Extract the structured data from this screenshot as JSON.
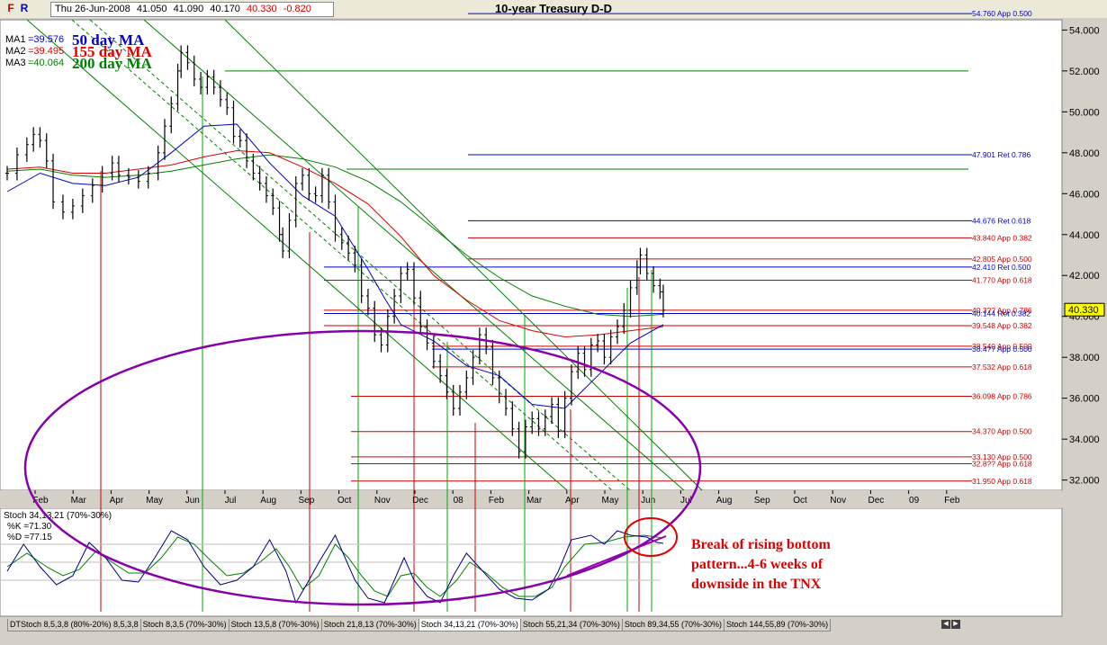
{
  "window": {
    "title": "10-year Treasury D-D",
    "btn_f": "F",
    "btn_r": "R"
  },
  "quote": {
    "date": "Thu 26-Jun-2008",
    "open": "41.050",
    "high": "41.090",
    "low": "40.170",
    "close": "40.330",
    "change": "-0.820"
  },
  "ma_legend": [
    {
      "label": "MA1",
      "value": "=39.576",
      "big": "50 day MA",
      "color": "#0000cc"
    },
    {
      "label": "MA2",
      "value": "=39.495",
      "big": "155 day MA",
      "color": "#dd0000"
    },
    {
      "label": "MA3",
      "value": "=40.064",
      "big": "200 day MA",
      "color": "#008000"
    }
  ],
  "chart_data": {
    "type": "candlestick",
    "title": "10-year Treasury D-D",
    "y_axis": {
      "min": 31.5,
      "max": 54.5,
      "ticks": [
        32,
        34,
        36,
        38,
        40,
        42,
        44,
        46,
        48,
        50,
        52,
        54
      ],
      "tick_labels": [
        "32.000",
        "34.000",
        "36.000",
        "38.000",
        "40.000",
        "42.000",
        "44.000",
        "46.000",
        "48.000",
        "50.000",
        "52.000",
        "54.000"
      ],
      "last_price_label": "40.330"
    },
    "x_axis": {
      "labels": [
        "Feb",
        "Mar",
        "Apr",
        "May",
        "Jun",
        "Jul",
        "Aug",
        "Sep",
        "Oct",
        "Nov",
        "Dec",
        "08",
        "Feb",
        "Mar",
        "Apr",
        "May",
        "Jun",
        "Jul",
        "Aug",
        "Sep",
        "Oct",
        "Nov",
        "Dec",
        "09",
        "Feb"
      ]
    },
    "price": [
      [
        0,
        47.0
      ],
      [
        3,
        47.9
      ],
      [
        6,
        48.4
      ],
      [
        8,
        48.9
      ],
      [
        10,
        48.6
      ],
      [
        12,
        47.6
      ],
      [
        14,
        45.6
      ],
      [
        17,
        45.1
      ],
      [
        20,
        45.4
      ],
      [
        23,
        45.9
      ],
      [
        26,
        46.4
      ],
      [
        29,
        47.0
      ],
      [
        32,
        47.5
      ],
      [
        34,
        46.9
      ],
      [
        37,
        46.8
      ],
      [
        40,
        46.6
      ],
      [
        43,
        47.0
      ],
      [
        46,
        48.0
      ],
      [
        48,
        49.3
      ],
      [
        50,
        50.4
      ],
      [
        52,
        52.0
      ],
      [
        53,
        52.9
      ],
      [
        55,
        52.4
      ],
      [
        57,
        51.6
      ],
      [
        59,
        51.2
      ],
      [
        61,
        51.7
      ],
      [
        63,
        51.2
      ],
      [
        65,
        50.6
      ],
      [
        67,
        50.2
      ],
      [
        69,
        48.8
      ],
      [
        71,
        48.6
      ],
      [
        73,
        47.6
      ],
      [
        75,
        47.0
      ],
      [
        77,
        46.5
      ],
      [
        79,
        45.9
      ],
      [
        81,
        45.3
      ],
      [
        83,
        44.0
      ],
      [
        84,
        43.2
      ],
      [
        86,
        44.7
      ],
      [
        88,
        46.5
      ],
      [
        90,
        46.9
      ],
      [
        92,
        46.0
      ],
      [
        94,
        45.9
      ],
      [
        96,
        46.9
      ],
      [
        98,
        45.6
      ],
      [
        100,
        44.0
      ],
      [
        102,
        43.6
      ],
      [
        104,
        43.1
      ],
      [
        106,
        42.5
      ],
      [
        108,
        41.0
      ],
      [
        110,
        40.4
      ],
      [
        112,
        39.1
      ],
      [
        114,
        38.6
      ],
      [
        116,
        40.0
      ],
      [
        118,
        41.0
      ],
      [
        120,
        42.1
      ],
      [
        122,
        42.3
      ],
      [
        124,
        40.9
      ],
      [
        126,
        39.5
      ],
      [
        128,
        38.7
      ],
      [
        130,
        37.8
      ],
      [
        132,
        37.1
      ],
      [
        134,
        36.3
      ],
      [
        136,
        35.5
      ],
      [
        138,
        36.3
      ],
      [
        140,
        37.0
      ],
      [
        142,
        38.0
      ],
      [
        144,
        39.1
      ],
      [
        146,
        38.5
      ],
      [
        148,
        37.0
      ],
      [
        150,
        36.1
      ],
      [
        152,
        35.5
      ],
      [
        154,
        34.5
      ],
      [
        156,
        33.4
      ],
      [
        158,
        34.6
      ],
      [
        160,
        35.0
      ],
      [
        162,
        34.5
      ],
      [
        164,
        35.1
      ],
      [
        166,
        35.7
      ],
      [
        168,
        34.4
      ],
      [
        170,
        36.0
      ],
      [
        172,
        37.3
      ],
      [
        174,
        38.2
      ],
      [
        176,
        37.4
      ],
      [
        178,
        38.6
      ],
      [
        180,
        38.8
      ],
      [
        182,
        38.0
      ],
      [
        184,
        39.0
      ],
      [
        186,
        39.5
      ],
      [
        188,
        40.3
      ],
      [
        190,
        41.4
      ],
      [
        192,
        42.4
      ],
      [
        193,
        43.0
      ],
      [
        195,
        42.1
      ],
      [
        197,
        41.5
      ],
      [
        199,
        41.2
      ],
      [
        200,
        40.3
      ]
    ],
    "ma50": [
      [
        0,
        46.1
      ],
      [
        10,
        47.0
      ],
      [
        20,
        46.5
      ],
      [
        30,
        46.4
      ],
      [
        40,
        46.8
      ],
      [
        50,
        48.0
      ],
      [
        60,
        49.3
      ],
      [
        70,
        49.4
      ],
      [
        80,
        47.5
      ],
      [
        90,
        45.9
      ],
      [
        100,
        44.9
      ],
      [
        110,
        42.3
      ],
      [
        115,
        40.9
      ],
      [
        120,
        39.6
      ],
      [
        130,
        38.8
      ],
      [
        140,
        37.6
      ],
      [
        150,
        37.1
      ],
      [
        160,
        35.7
      ],
      [
        170,
        35.5
      ],
      [
        180,
        37.1
      ],
      [
        190,
        38.7
      ],
      [
        200,
        39.6
      ]
    ],
    "ma155": [
      [
        0,
        47.2
      ],
      [
        10,
        47.3
      ],
      [
        20,
        47.0
      ],
      [
        30,
        47.0
      ],
      [
        40,
        47.2
      ],
      [
        50,
        47.4
      ],
      [
        60,
        47.8
      ],
      [
        70,
        48.1
      ],
      [
        80,
        48.0
      ],
      [
        90,
        47.3
      ],
      [
        100,
        46.5
      ],
      [
        110,
        45.5
      ],
      [
        120,
        43.9
      ],
      [
        130,
        42.0
      ],
      [
        140,
        40.8
      ],
      [
        150,
        39.8
      ],
      [
        160,
        39.3
      ],
      [
        170,
        39.0
      ],
      [
        180,
        39.1
      ],
      [
        190,
        39.3
      ],
      [
        200,
        39.5
      ]
    ],
    "ma200": [
      [
        0,
        47.1
      ],
      [
        10,
        47.2
      ],
      [
        20,
        46.9
      ],
      [
        30,
        46.8
      ],
      [
        40,
        46.9
      ],
      [
        50,
        47.1
      ],
      [
        60,
        47.4
      ],
      [
        70,
        47.7
      ],
      [
        80,
        47.9
      ],
      [
        90,
        47.7
      ],
      [
        100,
        47.3
      ],
      [
        110,
        46.6
      ],
      [
        120,
        45.6
      ],
      [
        130,
        44.3
      ],
      [
        140,
        43.0
      ],
      [
        150,
        41.9
      ],
      [
        160,
        41.0
      ],
      [
        170,
        40.5
      ],
      [
        180,
        40.1
      ],
      [
        190,
        40.0
      ],
      [
        200,
        40.1
      ]
    ],
    "fib_levels": [
      {
        "value": 54.8,
        "label": "54.760 App 0.500",
        "color": "#0000cc"
      },
      {
        "value": 47.901,
        "label": "47.901 Ret 0.786",
        "color": "#0000cc"
      },
      {
        "value": 44.676,
        "label": "44.676 Ret 0.618",
        "color": "#0000cc"
      },
      {
        "value": 43.84,
        "label": "43.840 App 0.382",
        "color": "#cc0000"
      },
      {
        "value": 42.805,
        "label": "42.805 App 0.500",
        "color": "#cc0000"
      },
      {
        "value": 42.41,
        "label": "42.410 Ret 0.500",
        "color": "#0000cc"
      },
      {
        "value": 41.77,
        "label": "41.770 App 0.618",
        "color": "#cc0000"
      },
      {
        "value": 40.3,
        "label": "40.3?? App 0.786",
        "color": "#cc0000"
      },
      {
        "value": 40.144,
        "label": "40.144 Ret 0.382",
        "color": "#0000cc"
      },
      {
        "value": 39.548,
        "label": "39.548 App 0.382",
        "color": "#cc0000"
      },
      {
        "value": 38.54,
        "label": "38.540 App 0.500",
        "color": "#cc0000"
      },
      {
        "value": 38.4,
        "label": "38.4?? App 0.500",
        "color": "#0000cc"
      },
      {
        "value": 37.532,
        "label": "37.532 App 0.618",
        "color": "#cc0000"
      },
      {
        "value": 36.098,
        "label": "36.098 App 0.786",
        "color": "#cc0000"
      },
      {
        "value": 34.37,
        "label": "34.370 App 0.500",
        "color": "#cc0000"
      },
      {
        "value": 33.13,
        "label": "33.130 App 0.500",
        "color": "#cc0000"
      },
      {
        "value": 32.8,
        "label": "32.8?? App 0.618",
        "color": "#cc0000"
      },
      {
        "value": 31.95,
        "label": "31.950 App 0.618",
        "color": "#cc0000"
      }
    ],
    "stoch": {
      "title": "Stoch 34,13,21 (70%-30%)",
      "k_label": "%K =71.30",
      "d_label": "%D =77.15",
      "k": [
        [
          0,
          40
        ],
        [
          5,
          70
        ],
        [
          10,
          45
        ],
        [
          15,
          25
        ],
        [
          20,
          35
        ],
        [
          25,
          72
        ],
        [
          30,
          55
        ],
        [
          35,
          30
        ],
        [
          40,
          28
        ],
        [
          45,
          55
        ],
        [
          50,
          85
        ],
        [
          55,
          75
        ],
        [
          60,
          45
        ],
        [
          65,
          25
        ],
        [
          70,
          30
        ],
        [
          75,
          45
        ],
        [
          80,
          75
        ],
        [
          85,
          40
        ],
        [
          88,
          5
        ],
        [
          92,
          30
        ],
        [
          95,
          50
        ],
        [
          100,
          80
        ],
        [
          103,
          55
        ],
        [
          106,
          30
        ],
        [
          110,
          10
        ],
        [
          115,
          5
        ],
        [
          118,
          30
        ],
        [
          121,
          55
        ],
        [
          124,
          30
        ],
        [
          128,
          12
        ],
        [
          132,
          5
        ],
        [
          136,
          35
        ],
        [
          140,
          60
        ],
        [
          145,
          40
        ],
        [
          150,
          20
        ],
        [
          155,
          10
        ],
        [
          160,
          8
        ],
        [
          165,
          20
        ],
        [
          168,
          40
        ],
        [
          172,
          75
        ],
        [
          178,
          80
        ],
        [
          182,
          70
        ],
        [
          186,
          85
        ],
        [
          190,
          80
        ],
        [
          195,
          78
        ],
        [
          198,
          72
        ],
        [
          200,
          71
        ]
      ],
      "d": [
        [
          0,
          45
        ],
        [
          6,
          60
        ],
        [
          12,
          45
        ],
        [
          17,
          35
        ],
        [
          22,
          42
        ],
        [
          27,
          62
        ],
        [
          32,
          50
        ],
        [
          37,
          38
        ],
        [
          42,
          38
        ],
        [
          47,
          55
        ],
        [
          52,
          78
        ],
        [
          57,
          70
        ],
        [
          62,
          52
        ],
        [
          67,
          35
        ],
        [
          72,
          38
        ],
        [
          77,
          50
        ],
        [
          82,
          65
        ],
        [
          86,
          45
        ],
        [
          90,
          20
        ],
        [
          95,
          35
        ],
        [
          100,
          70
        ],
        [
          104,
          55
        ],
        [
          108,
          35
        ],
        [
          112,
          18
        ],
        [
          116,
          12
        ],
        [
          120,
          35
        ],
        [
          124,
          38
        ],
        [
          128,
          22
        ],
        [
          132,
          12
        ],
        [
          137,
          30
        ],
        [
          141,
          50
        ],
        [
          146,
          38
        ],
        [
          151,
          22
        ],
        [
          156,
          12
        ],
        [
          161,
          12
        ],
        [
          166,
          22
        ],
        [
          170,
          45
        ],
        [
          176,
          70
        ],
        [
          182,
          72
        ],
        [
          188,
          78
        ],
        [
          194,
          80
        ],
        [
          200,
          77
        ]
      ]
    }
  },
  "annotation": {
    "lines": [
      "Break of rising bottom",
      "pattern...4-6 weeks of",
      "downside in the TNX"
    ],
    "color": "#e00000"
  },
  "tabs": [
    "DTStoch 8,5,3,8 (80%-20%) 8,5,3,8",
    "Stoch 8,3,5 (70%-30%)",
    "Stoch 13,5,8 (70%-30%)",
    "Stoch 21,8,13 (70%-30%)",
    "Stoch 34,13,21 (70%-30%)",
    "Stoch 55,21,34 (70%-30%)",
    "Stoch 89,34,55 (70%-30%)",
    "Stoch 144,55,89 (70%-30%)"
  ],
  "active_tab": 4
}
